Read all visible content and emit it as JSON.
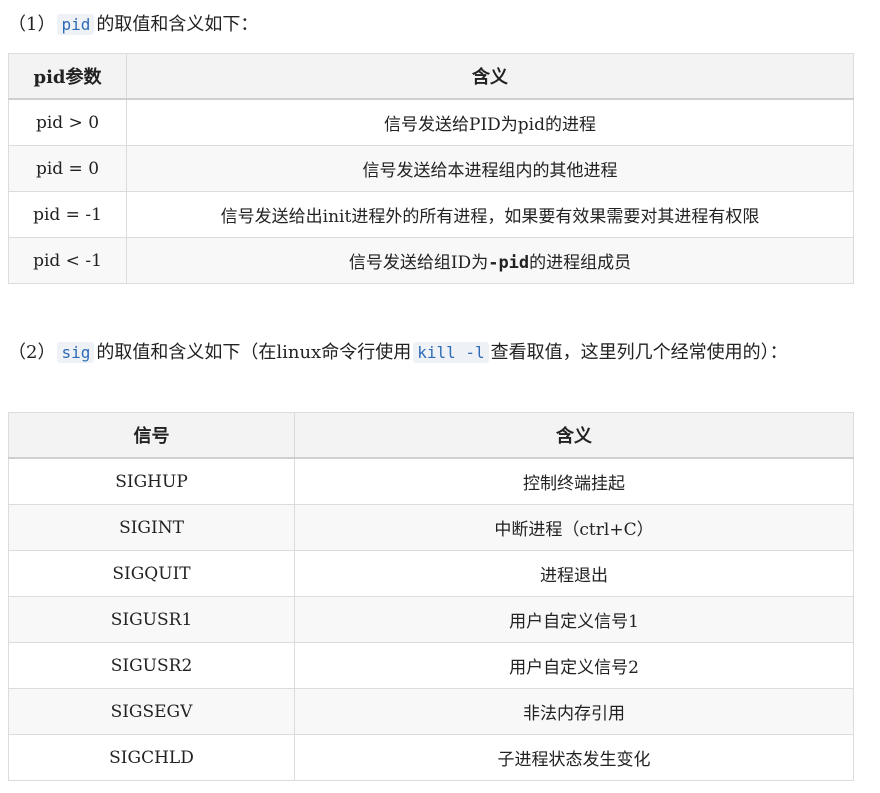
{
  "section1": {
    "prefix": "（1）",
    "code": "pid",
    "suffix": "的取值和含义如下："
  },
  "table1": {
    "headers": [
      "pid参数",
      "含义"
    ],
    "rows": [
      [
        "pid > 0",
        "信号发送给PID为pid的进程"
      ],
      [
        "pid = 0",
        "信号发送给本进程组内的其他进程"
      ],
      [
        "pid = -1",
        "信号发送给出init进程外的所有进程，如果要有效果需要对其进程有权限"
      ],
      [
        "pid < -1",
        "信号发送给组ID为",
        "-pid",
        "的进程组成员"
      ]
    ]
  },
  "section2": {
    "prefix": "（2）",
    "code1": "sig",
    "middle": "的取值和含义如下（在linux命令行使用",
    "code2": "kill -l",
    "suffix": "查看取值，这里列几个经常使用的）："
  },
  "table2": {
    "headers": [
      "信号",
      "含义"
    ],
    "rows": [
      [
        "SIGHUP",
        "控制终端挂起"
      ],
      [
        "SIGINT",
        "中断进程（ctrl+C）"
      ],
      [
        "SIGQUIT",
        "进程退出"
      ],
      [
        "SIGUSR1",
        "用户自定义信号1"
      ],
      [
        "SIGUSR2",
        "用户自定义信号2"
      ],
      [
        "SIGSEGV",
        "非法内存引用"
      ],
      [
        "SIGCHLD",
        "子进程状态发生变化"
      ]
    ]
  }
}
